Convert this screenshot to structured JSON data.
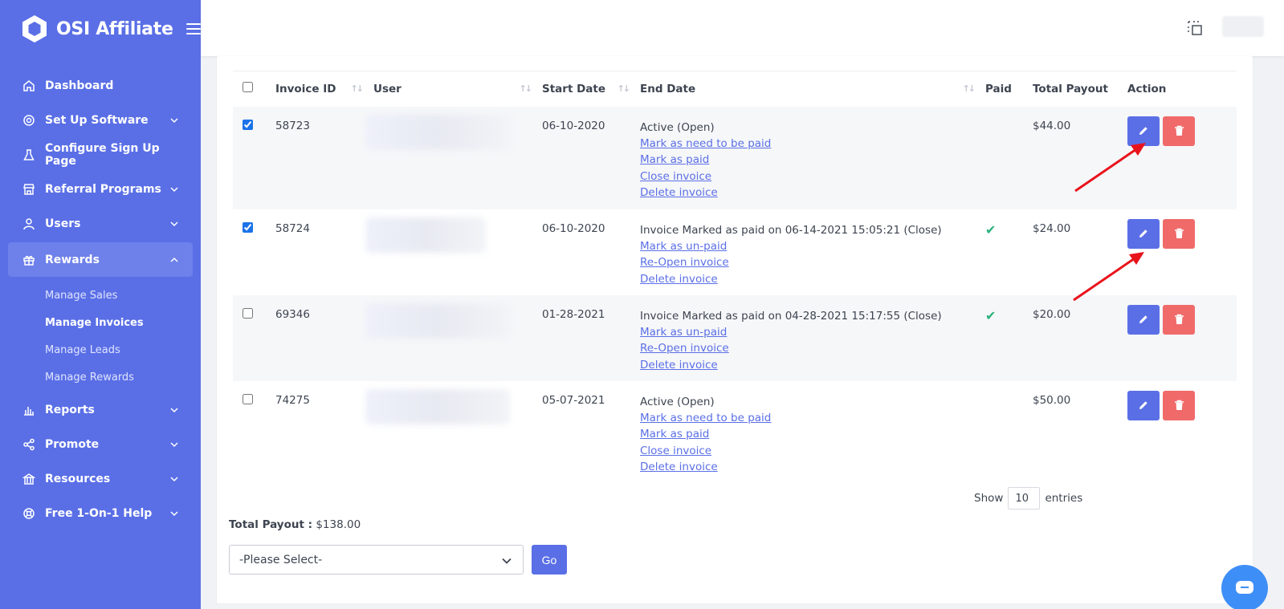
{
  "brand": {
    "name": "OSI Affiliate"
  },
  "sidebar": {
    "items": [
      {
        "label": "Dashboard",
        "icon": "home-icon"
      },
      {
        "label": "Set Up Software",
        "icon": "gear-icon"
      },
      {
        "label": "Configure Sign Up Page",
        "icon": "flask-icon"
      },
      {
        "label": "Referral Programs",
        "icon": "store-icon"
      },
      {
        "label": "Users",
        "icon": "user-icon"
      },
      {
        "label": "Rewards",
        "icon": "gift-icon"
      },
      {
        "label": "Reports",
        "icon": "bar-chart-icon"
      },
      {
        "label": "Promote",
        "icon": "share-icon"
      },
      {
        "label": "Resources",
        "icon": "bank-icon"
      },
      {
        "label": "Free 1-On-1 Help",
        "icon": "lifebuoy-icon"
      }
    ],
    "rewards_sub": [
      "Manage Sales",
      "Manage Invoices",
      "Manage Leads",
      "Manage Rewards"
    ]
  },
  "table": {
    "headers": {
      "invoice_id": "Invoice ID",
      "user": "User",
      "start_date": "Start Date",
      "end_date": "End Date",
      "paid": "Paid",
      "total_payout": "Total Payout",
      "action": "Action"
    },
    "rows": [
      {
        "checked": true,
        "invoice_id": "58723",
        "start_date": "06-10-2020",
        "status": "Active (Open)",
        "links": [
          "Mark as need to be paid",
          "Mark as paid",
          "Close invoice",
          "Delete invoice"
        ],
        "paid": false,
        "total": "$44.00"
      },
      {
        "checked": true,
        "invoice_id": "58724",
        "start_date": "06-10-2020",
        "status": "Invoice Marked as paid on 06-14-2021 15:05:21 (Close)",
        "links": [
          "Mark as un-paid",
          "Re-Open invoice",
          "Delete invoice"
        ],
        "paid": true,
        "total": "$24.00"
      },
      {
        "checked": false,
        "invoice_id": "69346",
        "start_date": "01-28-2021",
        "status": "Invoice Marked as paid on 04-28-2021 15:17:55 (Close)",
        "links": [
          "Mark as un-paid",
          "Re-Open invoice",
          "Delete invoice"
        ],
        "paid": true,
        "total": "$20.00"
      },
      {
        "checked": false,
        "invoice_id": "74275",
        "start_date": "05-07-2021",
        "status": "Active (Open)",
        "links": [
          "Mark as need to be paid",
          "Mark as paid",
          "Close invoice",
          "Delete invoice"
        ],
        "paid": false,
        "total": "$50.00"
      }
    ]
  },
  "pagination": {
    "show_label": "Show",
    "entries_value": "10",
    "entries_label": "entries"
  },
  "summary": {
    "total_label": "Total Payout :",
    "total_value": "$138.00"
  },
  "bulk": {
    "select_placeholder": "-Please Select-",
    "go_label": "Go"
  },
  "colors": {
    "accent": "#5a6fe6",
    "danger": "#f06a6a",
    "success": "#2ab27b",
    "annotation": "#e8141c"
  }
}
